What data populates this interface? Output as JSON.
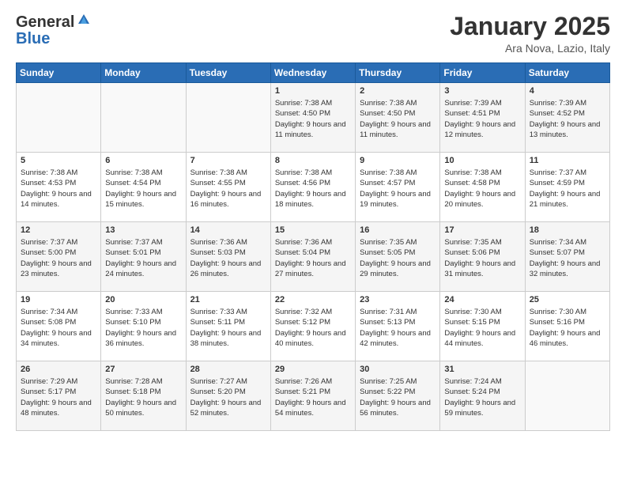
{
  "logo": {
    "general": "General",
    "blue": "Blue"
  },
  "header": {
    "month": "January 2025",
    "location": "Ara Nova, Lazio, Italy"
  },
  "weekdays": [
    "Sunday",
    "Monday",
    "Tuesday",
    "Wednesday",
    "Thursday",
    "Friday",
    "Saturday"
  ],
  "weeks": [
    [
      {
        "day": "",
        "sunrise": "",
        "sunset": "",
        "daylight": ""
      },
      {
        "day": "",
        "sunrise": "",
        "sunset": "",
        "daylight": ""
      },
      {
        "day": "",
        "sunrise": "",
        "sunset": "",
        "daylight": ""
      },
      {
        "day": "1",
        "sunrise": "Sunrise: 7:38 AM",
        "sunset": "Sunset: 4:50 PM",
        "daylight": "Daylight: 9 hours and 11 minutes."
      },
      {
        "day": "2",
        "sunrise": "Sunrise: 7:38 AM",
        "sunset": "Sunset: 4:50 PM",
        "daylight": "Daylight: 9 hours and 11 minutes."
      },
      {
        "day": "3",
        "sunrise": "Sunrise: 7:39 AM",
        "sunset": "Sunset: 4:51 PM",
        "daylight": "Daylight: 9 hours and 12 minutes."
      },
      {
        "day": "4",
        "sunrise": "Sunrise: 7:39 AM",
        "sunset": "Sunset: 4:52 PM",
        "daylight": "Daylight: 9 hours and 13 minutes."
      }
    ],
    [
      {
        "day": "5",
        "sunrise": "Sunrise: 7:38 AM",
        "sunset": "Sunset: 4:53 PM",
        "daylight": "Daylight: 9 hours and 14 minutes."
      },
      {
        "day": "6",
        "sunrise": "Sunrise: 7:38 AM",
        "sunset": "Sunset: 4:54 PM",
        "daylight": "Daylight: 9 hours and 15 minutes."
      },
      {
        "day": "7",
        "sunrise": "Sunrise: 7:38 AM",
        "sunset": "Sunset: 4:55 PM",
        "daylight": "Daylight: 9 hours and 16 minutes."
      },
      {
        "day": "8",
        "sunrise": "Sunrise: 7:38 AM",
        "sunset": "Sunset: 4:56 PM",
        "daylight": "Daylight: 9 hours and 18 minutes."
      },
      {
        "day": "9",
        "sunrise": "Sunrise: 7:38 AM",
        "sunset": "Sunset: 4:57 PM",
        "daylight": "Daylight: 9 hours and 19 minutes."
      },
      {
        "day": "10",
        "sunrise": "Sunrise: 7:38 AM",
        "sunset": "Sunset: 4:58 PM",
        "daylight": "Daylight: 9 hours and 20 minutes."
      },
      {
        "day": "11",
        "sunrise": "Sunrise: 7:37 AM",
        "sunset": "Sunset: 4:59 PM",
        "daylight": "Daylight: 9 hours and 21 minutes."
      }
    ],
    [
      {
        "day": "12",
        "sunrise": "Sunrise: 7:37 AM",
        "sunset": "Sunset: 5:00 PM",
        "daylight": "Daylight: 9 hours and 23 minutes."
      },
      {
        "day": "13",
        "sunrise": "Sunrise: 7:37 AM",
        "sunset": "Sunset: 5:01 PM",
        "daylight": "Daylight: 9 hours and 24 minutes."
      },
      {
        "day": "14",
        "sunrise": "Sunrise: 7:36 AM",
        "sunset": "Sunset: 5:03 PM",
        "daylight": "Daylight: 9 hours and 26 minutes."
      },
      {
        "day": "15",
        "sunrise": "Sunrise: 7:36 AM",
        "sunset": "Sunset: 5:04 PM",
        "daylight": "Daylight: 9 hours and 27 minutes."
      },
      {
        "day": "16",
        "sunrise": "Sunrise: 7:35 AM",
        "sunset": "Sunset: 5:05 PM",
        "daylight": "Daylight: 9 hours and 29 minutes."
      },
      {
        "day": "17",
        "sunrise": "Sunrise: 7:35 AM",
        "sunset": "Sunset: 5:06 PM",
        "daylight": "Daylight: 9 hours and 31 minutes."
      },
      {
        "day": "18",
        "sunrise": "Sunrise: 7:34 AM",
        "sunset": "Sunset: 5:07 PM",
        "daylight": "Daylight: 9 hours and 32 minutes."
      }
    ],
    [
      {
        "day": "19",
        "sunrise": "Sunrise: 7:34 AM",
        "sunset": "Sunset: 5:08 PM",
        "daylight": "Daylight: 9 hours and 34 minutes."
      },
      {
        "day": "20",
        "sunrise": "Sunrise: 7:33 AM",
        "sunset": "Sunset: 5:10 PM",
        "daylight": "Daylight: 9 hours and 36 minutes."
      },
      {
        "day": "21",
        "sunrise": "Sunrise: 7:33 AM",
        "sunset": "Sunset: 5:11 PM",
        "daylight": "Daylight: 9 hours and 38 minutes."
      },
      {
        "day": "22",
        "sunrise": "Sunrise: 7:32 AM",
        "sunset": "Sunset: 5:12 PM",
        "daylight": "Daylight: 9 hours and 40 minutes."
      },
      {
        "day": "23",
        "sunrise": "Sunrise: 7:31 AM",
        "sunset": "Sunset: 5:13 PM",
        "daylight": "Daylight: 9 hours and 42 minutes."
      },
      {
        "day": "24",
        "sunrise": "Sunrise: 7:30 AM",
        "sunset": "Sunset: 5:15 PM",
        "daylight": "Daylight: 9 hours and 44 minutes."
      },
      {
        "day": "25",
        "sunrise": "Sunrise: 7:30 AM",
        "sunset": "Sunset: 5:16 PM",
        "daylight": "Daylight: 9 hours and 46 minutes."
      }
    ],
    [
      {
        "day": "26",
        "sunrise": "Sunrise: 7:29 AM",
        "sunset": "Sunset: 5:17 PM",
        "daylight": "Daylight: 9 hours and 48 minutes."
      },
      {
        "day": "27",
        "sunrise": "Sunrise: 7:28 AM",
        "sunset": "Sunset: 5:18 PM",
        "daylight": "Daylight: 9 hours and 50 minutes."
      },
      {
        "day": "28",
        "sunrise": "Sunrise: 7:27 AM",
        "sunset": "Sunset: 5:20 PM",
        "daylight": "Daylight: 9 hours and 52 minutes."
      },
      {
        "day": "29",
        "sunrise": "Sunrise: 7:26 AM",
        "sunset": "Sunset: 5:21 PM",
        "daylight": "Daylight: 9 hours and 54 minutes."
      },
      {
        "day": "30",
        "sunrise": "Sunrise: 7:25 AM",
        "sunset": "Sunset: 5:22 PM",
        "daylight": "Daylight: 9 hours and 56 minutes."
      },
      {
        "day": "31",
        "sunrise": "Sunrise: 7:24 AM",
        "sunset": "Sunset: 5:24 PM",
        "daylight": "Daylight: 9 hours and 59 minutes."
      },
      {
        "day": "",
        "sunrise": "",
        "sunset": "",
        "daylight": ""
      }
    ]
  ]
}
